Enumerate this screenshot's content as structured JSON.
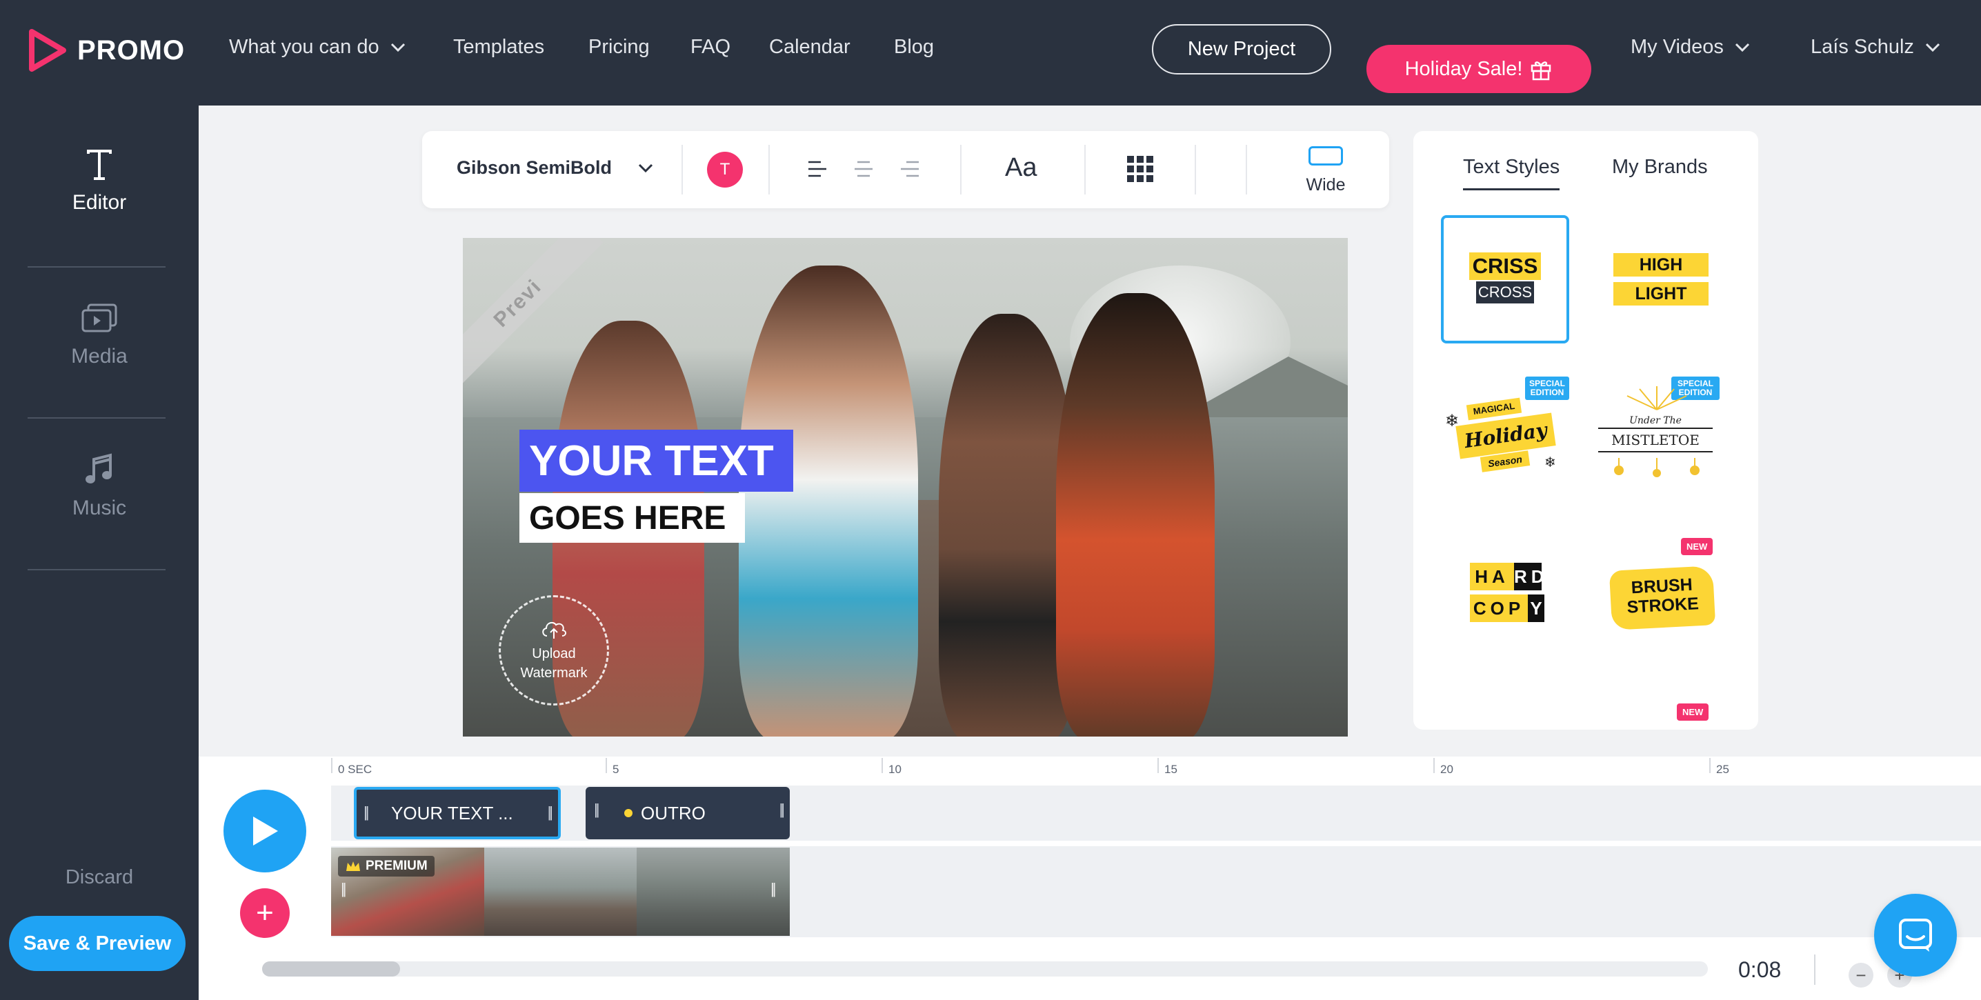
{
  "nav": {
    "brand": "PROMO",
    "items": [
      {
        "label": "What you can do",
        "dropdown": true
      },
      {
        "label": "Templates"
      },
      {
        "label": "Pricing"
      },
      {
        "label": "FAQ"
      },
      {
        "label": "Calendar"
      },
      {
        "label": "Blog"
      }
    ],
    "new_project": "New Project",
    "sale": "Holiday Sale!",
    "my_videos": "My Videos",
    "user": "Laís Schulz"
  },
  "sidebar": {
    "items": [
      {
        "label": "Editor",
        "icon": "text-t-icon",
        "active": true
      },
      {
        "label": "Media",
        "icon": "media-icon"
      },
      {
        "label": "Music",
        "icon": "music-note-icon"
      }
    ],
    "discard": "Discard",
    "save": "Save & Preview"
  },
  "toolbar": {
    "font": "Gibson SemiBold",
    "color_letter": "T",
    "color": "#f4336e",
    "size_label": "Aa",
    "ratio": "Wide"
  },
  "preview": {
    "ribbon": "Previ",
    "line1": "YOUR TEXT",
    "line2": "GOES HERE",
    "watermark": "Upload Watermark"
  },
  "panel": {
    "tabs": [
      "Text Styles",
      "My Brands"
    ],
    "styles": [
      {
        "name": "criss-cross",
        "line1": "CRISS",
        "line2": "CROSS",
        "selected": true
      },
      {
        "name": "highlight",
        "line1": "HIGH",
        "line2": "LIGHT"
      },
      {
        "name": "holiday",
        "badge": "SPECIAL EDITION",
        "line1": "MAGICAL",
        "line2": "Holiday",
        "line3": "Season"
      },
      {
        "name": "mistletoe",
        "badge": "SPECIAL EDITION",
        "line1": "Under The",
        "line2": "MISTLETOE"
      },
      {
        "name": "hardcopy",
        "line1": "HARD",
        "line2": "COPY"
      },
      {
        "name": "brushstroke",
        "badge": "NEW",
        "line1": "BRUSH",
        "line2": "STROKE"
      }
    ],
    "more_badge": "NEW"
  },
  "timeline": {
    "ruler": [
      "0 SEC",
      "5",
      "10",
      "15",
      "20",
      "25"
    ],
    "clips": [
      "YOUR TEXT ...",
      "OUTRO"
    ],
    "premium": "PREMIUM",
    "time": "0:08",
    "zoom_out": "−",
    "zoom_in": "+"
  }
}
